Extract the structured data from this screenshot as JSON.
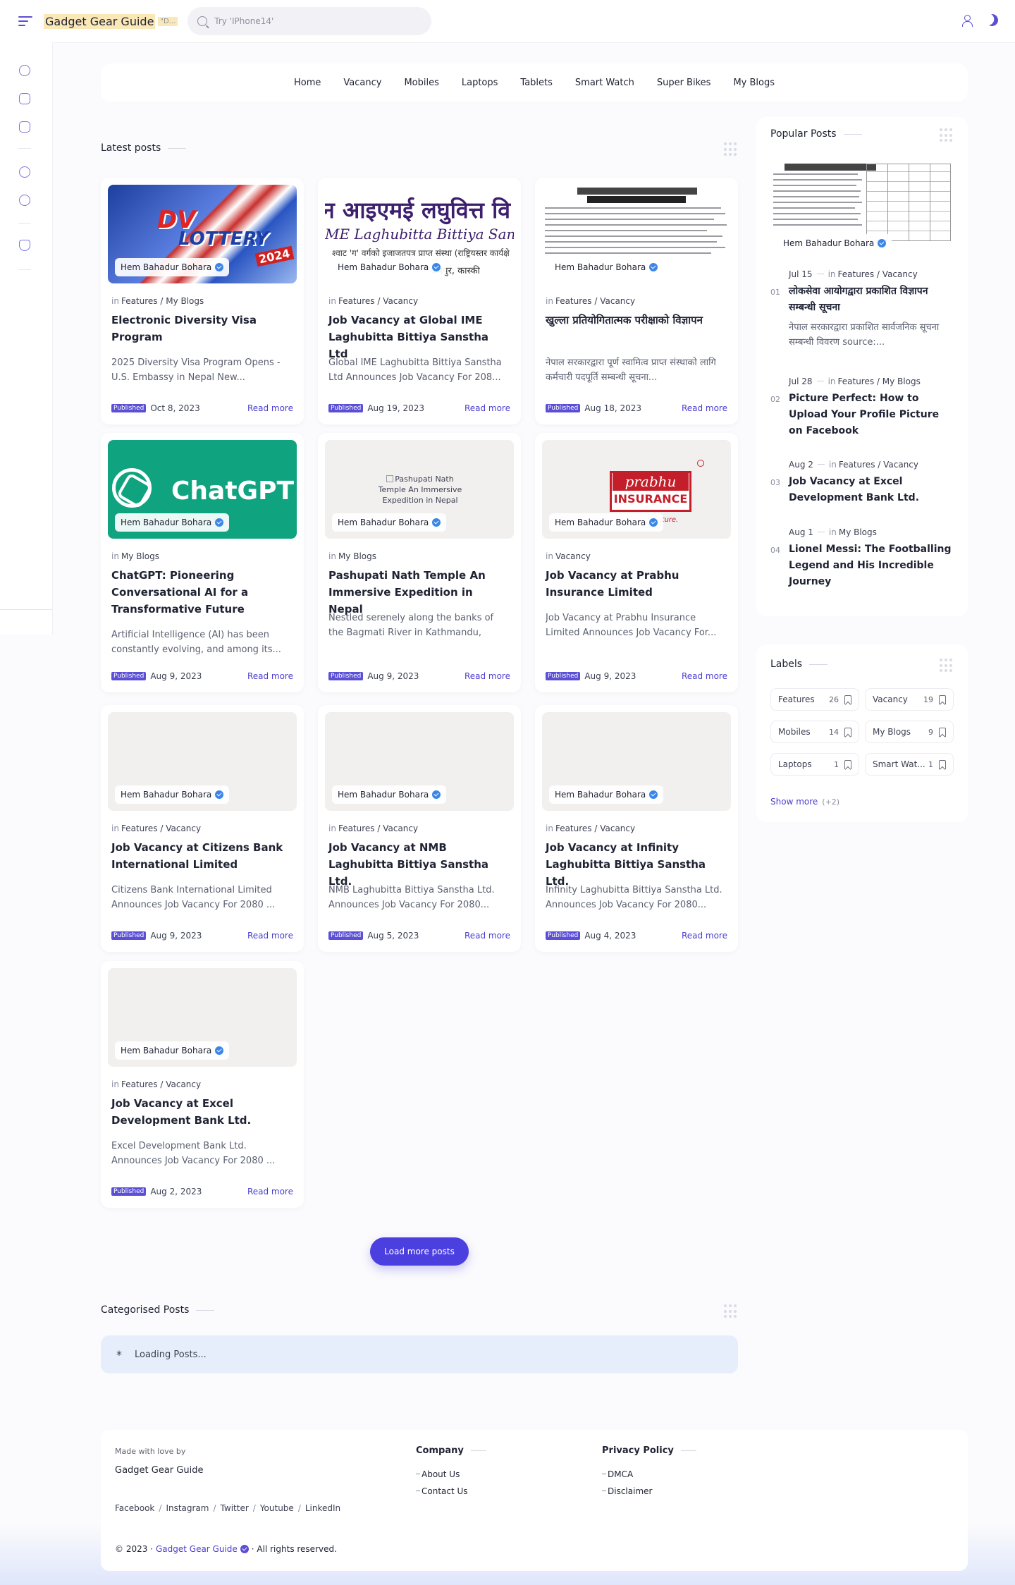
{
  "header": {
    "brand": "Gadget Gear Guide",
    "brand_tag": "\"D...",
    "search_placeholder": "Try 'IPhone14'"
  },
  "nav": [
    "Home",
    "Vacancy",
    "Mobiles",
    "Laptops",
    "Tablets",
    "Smart Watch",
    "Super Bikes",
    "My Blogs"
  ],
  "latest": {
    "title": "Latest posts",
    "posts": [
      {
        "author": "Hem Bahadur Bohara",
        "in": "in",
        "category": "Features / My Blogs",
        "title": "Electronic Diversity Visa Program",
        "excerpt": "2025 Diversity Visa Program Opens - U.S. Embassy in Nepal New...",
        "badge": "Published",
        "date": "Oct 8, 2023",
        "read_more": "Read more",
        "thumb_text": [
          "DV",
          "LOTTERY",
          "2024"
        ]
      },
      {
        "author": "Hem Bahadur Bohara",
        "in": "in",
        "category": "Features / Vacancy",
        "title": "Job Vacancy at Global IME Laghubitta Bittiya Sanstha Ltd",
        "excerpt": "Global IME Laghubitta Bittiya Sanstha Ltd   Announces Job Vacancy For 208...",
        "badge": "Published",
        "date": "Aug 19, 2023",
        "read_more": "Read more",
        "thumb_text": [
          "न आइएमई लघुवित्त वि",
          "ME Laghubitta Bittiya Sanstha L",
          "श्वाट 'ग' वर्गको इजाजतपत्र प्राप्त संस्था (राष्ट्रियस्तर कार्यक्षे",
          "जयपुर, कास्की"
        ]
      },
      {
        "author": "Hem Bahadur Bohara",
        "in": "in",
        "category": "Features / Vacancy",
        "title": "खुल्ला प्रतियोगितात्मक परीक्षाको विज्ञापन",
        "excerpt": "नेपाल सरकारद्वारा पूर्ण स्वामित्व प्राप्त संस्थाको लागि कर्मचारी पदपूर्ति सम्बन्धी सूचना...",
        "badge": "Published",
        "date": "Aug 18, 2023",
        "read_more": "Read more"
      },
      {
        "author": "Hem Bahadur Bohara",
        "in": "in",
        "category": "My Blogs",
        "title": "ChatGPT: Pioneering Conversational AI for a Transformative Future",
        "excerpt": "Artificial Intelligence (AI) has been constantly evolving, and among its...",
        "badge": "Published",
        "date": "Aug 9, 2023",
        "read_more": "Read more",
        "thumb_text": [
          "ChatGPT"
        ]
      },
      {
        "author": "Hem Bahadur Bohara",
        "in": "in",
        "category": "My Blogs",
        "title": "Pashupati Nath Temple An Immersive Expedition in Nepal",
        "excerpt": "Nestled serenely along the banks of the Bagmati River in Kathmandu, Nepal, th...",
        "badge": "Published",
        "date": "Aug 9, 2023",
        "read_more": "Read more",
        "thumb_text": [
          "Pashupati Nath Temple An Immersive Expedition in Nepal"
        ]
      },
      {
        "author": "Hem Bahadur Bohara",
        "in": "in",
        "category": "Vacancy",
        "title": "Job Vacancy at Prabhu Insurance Limited",
        "excerpt": "Job Vacancy at Prabhu Insurance Limited  Announces Job Vacancy For...",
        "badge": "Published",
        "date": "Aug 9, 2023",
        "read_more": "Read more",
        "thumb_text": [
          "prabhu",
          "INSURANCE",
          "...ture."
        ]
      },
      {
        "author": "Hem Bahadur Bohara",
        "in": "in",
        "category": "Features / Vacancy",
        "title": "Job Vacancy at Citizens Bank International Limited",
        "excerpt": "Citizens Bank International Limited Announces Job Vacancy For 2080      ...",
        "badge": "Published",
        "date": "Aug 9, 2023",
        "read_more": "Read more"
      },
      {
        "author": "Hem Bahadur Bohara",
        "in": "in",
        "category": "Features / Vacancy",
        "title": "Job Vacancy at NMB Laghubitta Bittiya Sanstha Ltd.",
        "excerpt": "NMB Laghubitta Bittiya Sanstha Ltd. Announces Job Vacancy For 2080...",
        "badge": "Published",
        "date": "Aug 5, 2023",
        "read_more": "Read more"
      },
      {
        "author": "Hem Bahadur Bohara",
        "in": "in",
        "category": "Features / Vacancy",
        "title": "Job Vacancy at Infinity Laghubitta Bittiya Sanstha Ltd.",
        "excerpt": "Infinity Laghubitta Bittiya Sanstha Ltd. Announces Job Vacancy For 2080...",
        "badge": "Published",
        "date": "Aug 4, 2023",
        "read_more": "Read more"
      },
      {
        "author": "Hem Bahadur Bohara",
        "in": "in",
        "category": "Features / Vacancy",
        "title": "Job Vacancy at Excel Development Bank Ltd.",
        "excerpt": "Excel Development Bank Ltd. Announces Job Vacancy For 2080      ...",
        "badge": "Published",
        "date": "Aug 2, 2023",
        "read_more": "Read more"
      }
    ],
    "load_more": "Load more posts"
  },
  "categorised": {
    "title": "Categorised Posts",
    "loading_icon": "*",
    "loading": "Loading Posts..."
  },
  "popular": {
    "title": "Popular Posts",
    "thumb_author": "Hem Bahadur Bohara",
    "items": [
      {
        "num": "01",
        "date": "Jul 15",
        "in": "in",
        "category": "Features / Vacancy",
        "title": "लोकसेवा आयोगद्वारा प्रकाशित विज्ञापन सम्बन्धी सूचना",
        "excerpt": "नेपाल सरकारद्वारा प्रकाशित सार्वजनिक सूचना सम्बन्धी विवरण source:..."
      },
      {
        "num": "02",
        "date": "Jul 28",
        "in": "in",
        "category": "Features / My Blogs",
        "title": "Picture Perfect: How to Upload Your Profile Picture on Facebook"
      },
      {
        "num": "03",
        "date": "Aug 2",
        "in": "in",
        "category": "Features / Vacancy",
        "title": "Job Vacancy at Excel Development Bank Ltd."
      },
      {
        "num": "04",
        "date": "Aug 1",
        "in": "in",
        "category": "My Blogs",
        "title": "Lionel Messi: The Footballing Legend and His Incredible Journey"
      }
    ]
  },
  "labels": {
    "title": "Labels",
    "chips": [
      {
        "name": "Features",
        "count": "26"
      },
      {
        "name": "Vacancy",
        "count": "19"
      },
      {
        "name": "Mobiles",
        "count": "14"
      },
      {
        "name": "My Blogs",
        "count": "9"
      },
      {
        "name": "Laptops",
        "count": "1"
      },
      {
        "name": "Smart Wat...",
        "count": "1"
      }
    ],
    "show_more": "Show more",
    "show_more_count": "(+2)"
  },
  "footer": {
    "made_with": "Made with love by",
    "brand": "Gadget Gear Guide",
    "social": [
      "Facebook",
      "Instagram",
      "Twitter",
      "Youtube",
      "LinkedIn"
    ],
    "social_sep": "/",
    "company_title": "Company",
    "company_links": [
      "About Us",
      "Contact Us"
    ],
    "privacy_title": "Privacy Policy",
    "privacy_links": [
      "DMCA",
      "Disclaimer"
    ],
    "copy_prefix": "© 2023 ·",
    "copy_brand": "Gadget Gear Guide",
    "copy_suffix": "· All rights reserved."
  },
  "colors": {
    "accent": "#4b3fe0",
    "badge": "#5b4fd6",
    "verified": "#3a86e8",
    "loading_bg": "#e6eefc"
  },
  "icons": [
    "menu-icon",
    "search-icon",
    "user-icon",
    "moon-icon",
    "verified-icon",
    "bookmark-icon",
    "drag-dots-icon"
  ]
}
